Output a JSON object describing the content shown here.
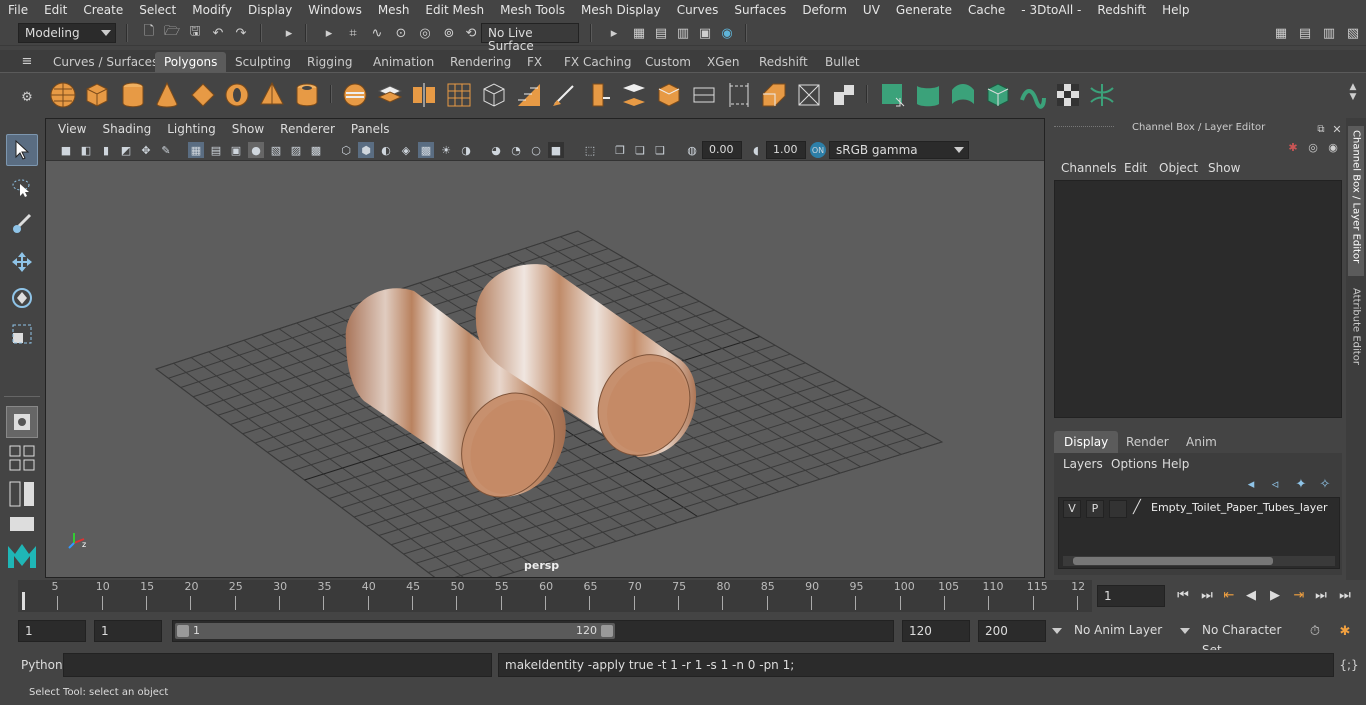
{
  "menubar": {
    "items": [
      "File",
      "Edit",
      "Create",
      "Select",
      "Modify",
      "Display",
      "Windows",
      "Mesh",
      "Edit Mesh",
      "Mesh Tools",
      "Mesh Display",
      "Curves",
      "Surfaces",
      "Deform",
      "UV",
      "Generate",
      "Cache",
      "- 3DtoAll -",
      "Redshift",
      "Help"
    ]
  },
  "statusline": {
    "mode": "Modeling",
    "live_surface": "No Live Surface"
  },
  "shelf": {
    "tabs": [
      "Curves / Surfaces",
      "Polygons",
      "Sculpting",
      "Rigging",
      "Animation",
      "Rendering",
      "FX",
      "FX Caching",
      "Custom",
      "XGen",
      "Redshift",
      "Bullet"
    ],
    "active_tab": "Polygons"
  },
  "viewport": {
    "menu": [
      "View",
      "Shading",
      "Lighting",
      "Show",
      "Renderer",
      "Panels"
    ],
    "exposure": "0.00",
    "gamma": "1.00",
    "color_space": "sRGB gamma",
    "camera_label": "persp"
  },
  "channel_box": {
    "title": "Channel Box / Layer Editor",
    "menu": [
      "Channels",
      "Edit",
      "Object",
      "Show"
    ],
    "side_tabs": [
      "Channel Box / Layer Editor",
      "Attribute Editor"
    ]
  },
  "layer_editor": {
    "tabs": [
      "Display",
      "Render",
      "Anim"
    ],
    "active_tab": "Display",
    "menu": [
      "Layers",
      "Options",
      "Help"
    ],
    "layer": {
      "visible": "V",
      "playback": "P",
      "name": "Empty_Toilet_Paper_Tubes_layer"
    }
  },
  "timeline": {
    "ticks": [
      "5",
      "10",
      "15",
      "20",
      "25",
      "30",
      "35",
      "40",
      "45",
      "50",
      "55",
      "60",
      "65",
      "70",
      "75",
      "80",
      "85",
      "90",
      "95",
      "100",
      "105",
      "110",
      "115",
      "12"
    ],
    "start_label": "1",
    "current_frame": "1"
  },
  "range": {
    "start": "1",
    "playback_start": "1",
    "slider_start": "1",
    "slider_end": "120",
    "playback_end": "120",
    "end": "200",
    "anim_layer": "No Anim Layer",
    "character_set": "No Character Set"
  },
  "command": {
    "language": "Python",
    "output": "makeIdentity -apply true -t 1 -r 1 -s 1 -n 0 -pn 1;"
  },
  "help": {
    "text": "Select Tool: select an object"
  },
  "colors": {
    "accent": "#5285a6",
    "tube_color": "#c58a66",
    "grid_color": "#3a3a3a",
    "shelf_green": "#3ba27a"
  }
}
